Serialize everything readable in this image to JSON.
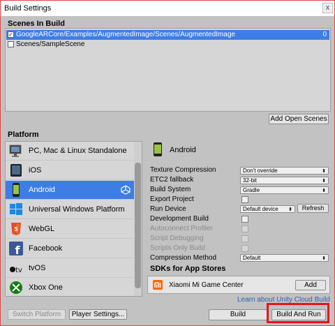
{
  "window": {
    "title": "Build Settings",
    "close": "x"
  },
  "scenes": {
    "header": "Scenes In Build",
    "items": [
      {
        "name": "GoogleARCore/Examples/AugmentedImage/Scenes/AugmentedImage",
        "index": "0",
        "checked": "✓"
      },
      {
        "name": "Scenes/SampleScene",
        "index": "",
        "checked": ""
      }
    ],
    "add_open_scenes": "Add Open Scenes"
  },
  "platform": {
    "header": "Platform",
    "items": [
      {
        "label": "PC, Mac & Linux Standalone",
        "icon": "pc-standalone-icon"
      },
      {
        "label": "iOS",
        "icon": "ios-icon"
      },
      {
        "label": "Android",
        "icon": "android-icon"
      },
      {
        "label": "Universal Windows Platform",
        "icon": "windows-icon"
      },
      {
        "label": "WebGL",
        "icon": "html5-icon"
      },
      {
        "label": "Facebook",
        "icon": "facebook-icon"
      },
      {
        "label": "tvOS",
        "icon": "tvos-icon"
      },
      {
        "label": "Xbox One",
        "icon": "xbox-icon"
      }
    ],
    "selected": "Android"
  },
  "settings": {
    "title": "Android",
    "texture_compression": {
      "label": "Texture Compression",
      "value": "Don't override"
    },
    "etc2_fallback": {
      "label": "ETC2 fallback",
      "value": "32-bit"
    },
    "build_system": {
      "label": "Build System",
      "value": "Gradle"
    },
    "export_project": {
      "label": "Export Project"
    },
    "run_device": {
      "label": "Run Device",
      "value": "Default device",
      "refresh": "Refresh"
    },
    "development_build": {
      "label": "Development Build"
    },
    "autoconnect_profiler": {
      "label": "Autoconnect Profiler"
    },
    "script_debugging": {
      "label": "Script Debugging"
    },
    "scripts_only_build": {
      "label": "Scripts Only Build"
    },
    "compression_method": {
      "label": "Compression Method",
      "value": "Default"
    }
  },
  "sdks": {
    "header": "SDKs for App Stores",
    "items": [
      {
        "label": "Xiaomi Mi Game Center",
        "button": "Add",
        "icon": "xiaomi-icon"
      }
    ]
  },
  "footer": {
    "cloud_build_link": "Learn about Unity Cloud Build",
    "switch_platform": "Switch Platform",
    "player_settings": "Player Settings...",
    "build": "Build",
    "build_and_run": "Build And Run"
  },
  "colors": {
    "selection": "#3d7de5",
    "highlight": "#e8141a",
    "panel": "#c2c2c2",
    "link": "#2a5fb8"
  }
}
